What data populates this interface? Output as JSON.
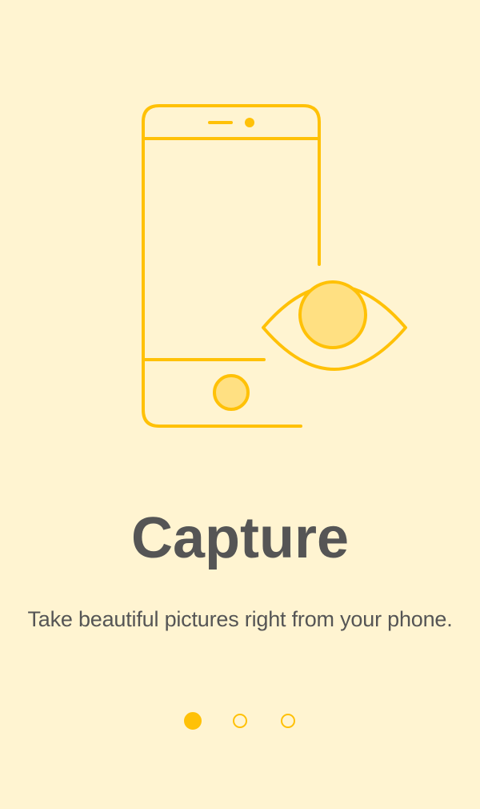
{
  "onboarding": {
    "title": "Capture",
    "subtitle": "Take beautiful pictures right from your phone.",
    "pager": {
      "page_count": 3,
      "active_index": 0
    }
  },
  "colors": {
    "background": "#FFF4D1",
    "accent": "#FFC107",
    "accent_light": "#FFE082",
    "text": "#555555"
  },
  "icons": {
    "illustration": [
      "phone-icon",
      "eye-icon"
    ]
  }
}
